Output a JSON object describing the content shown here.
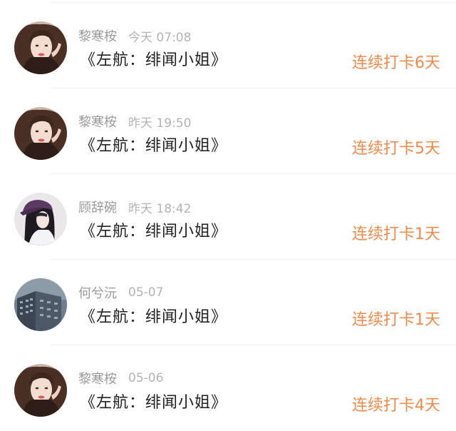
{
  "checkins": [
    {
      "name": "黎寒桉",
      "time": "今天 07:08",
      "book": "《左航：绯闻小姐》",
      "streak": "连续打卡6天",
      "avatar_icon": "girl-portrait-icon"
    },
    {
      "name": "黎寒桉",
      "time": "昨天 19:50",
      "book": "《左航：绯闻小姐》",
      "streak": "连续打卡5天",
      "avatar_icon": "girl-portrait-icon"
    },
    {
      "name": "顾辞碗",
      "time": "昨天 18:42",
      "book": "《左航：绯闻小姐》",
      "streak": "连续打卡1天",
      "avatar_icon": "girl-cap-icon"
    },
    {
      "name": "何兮沅",
      "time": "05-07",
      "book": "《左航：绯闻小姐》",
      "streak": "连续打卡1天",
      "avatar_icon": "building-icon"
    },
    {
      "name": "黎寒桉",
      "time": "05-06",
      "book": "《左航：绯闻小姐》",
      "streak": "连续打卡4天",
      "avatar_icon": "girl-portrait-icon"
    }
  ],
  "colors": {
    "accent": "#ef8a4a",
    "name": "#9a9a9a",
    "time": "#b3b3b3",
    "title": "#1f1f1f",
    "divider": "#f0f0f0"
  }
}
